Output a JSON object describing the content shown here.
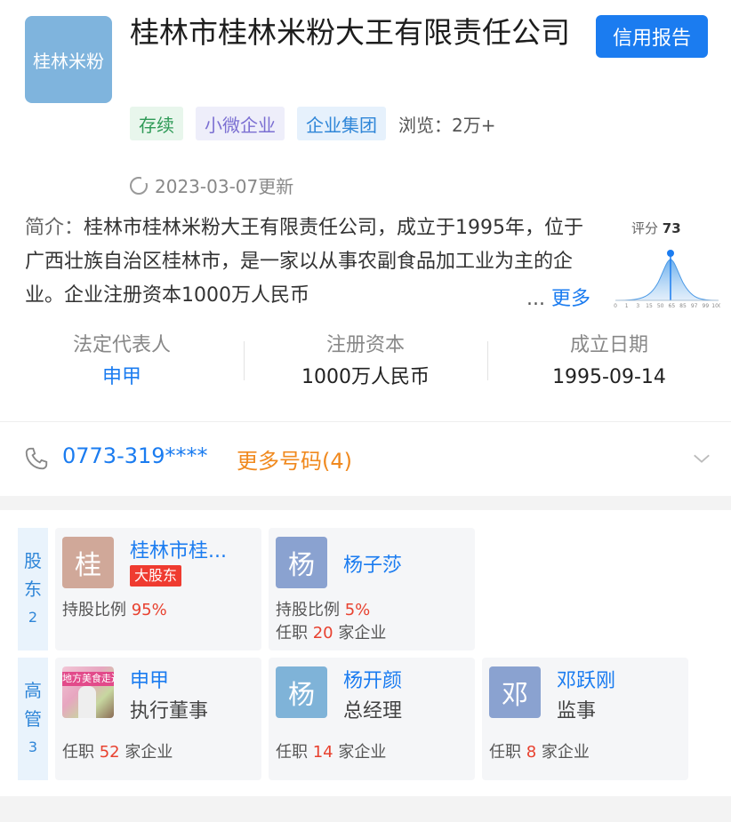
{
  "company": {
    "logo_text": "桂林米粉",
    "name": "桂林市桂林米粉大王有限责任公司",
    "credit_report": "信用报告",
    "tags": {
      "status": "存续",
      "size": "小微企业",
      "group": "企业集团"
    },
    "views": "浏览：2万+",
    "updated": "2023-03-07更新",
    "intro_label": "简介：",
    "intro": "桂林市桂林米粉大王有限责任公司，成立于1995年，位于广西壮族自治区桂林市，是一家以从事农副食品加工业为主的企业。企业注册资本1000万人民币",
    "intro_ellipsis": "...",
    "more_link": "更多",
    "score_label": "评分",
    "score_value": "73",
    "score_axis": [
      "0",
      "1",
      "3",
      "15",
      "50",
      "65",
      "85",
      "97",
      "99",
      "100"
    ]
  },
  "stats": [
    {
      "label": "法定代表人",
      "value": "申甲"
    },
    {
      "label": "注册资本",
      "value": "1000万人民币"
    },
    {
      "label": "成立日期",
      "value": "1995-09-14"
    }
  ],
  "phone": {
    "number": "0773-319****",
    "more": "更多号码(4)"
  },
  "shareholders": {
    "tab": "股东",
    "count": "2",
    "items": [
      {
        "avatar": "桂",
        "name": "桂林市桂...",
        "badge": "大股东",
        "ratio_label": "持股比例",
        "ratio": "95%",
        "avatar_color": "#d0a899"
      },
      {
        "avatar": "杨",
        "name": "杨子莎",
        "ratio_label": "持股比例",
        "ratio": "5%",
        "positions_pre": "任职",
        "positions": "20",
        "positions_post": "家企业",
        "avatar_color": "#8aa2d0"
      }
    ]
  },
  "executives": {
    "tab": "高管",
    "count": "3",
    "items": [
      {
        "photo_banner": "地方美食走进",
        "name": "申甲",
        "title": "执行董事",
        "positions_pre": "任职",
        "positions": "52",
        "positions_post": "家企业"
      },
      {
        "avatar": "杨",
        "name": "杨开颜",
        "title": "总经理",
        "positions_pre": "任职",
        "positions": "14",
        "positions_post": "家企业",
        "avatar_color": "#7fb3d8"
      },
      {
        "avatar": "邓",
        "name": "邓跃刚",
        "title": "监事",
        "positions_pre": "任职",
        "positions": "8",
        "positions_post": "家企业",
        "avatar_color": "#8aa2d0"
      }
    ]
  },
  "colors": {
    "accent": "#1b7cf0",
    "orange": "#f0891e",
    "red": "#e8412f"
  }
}
